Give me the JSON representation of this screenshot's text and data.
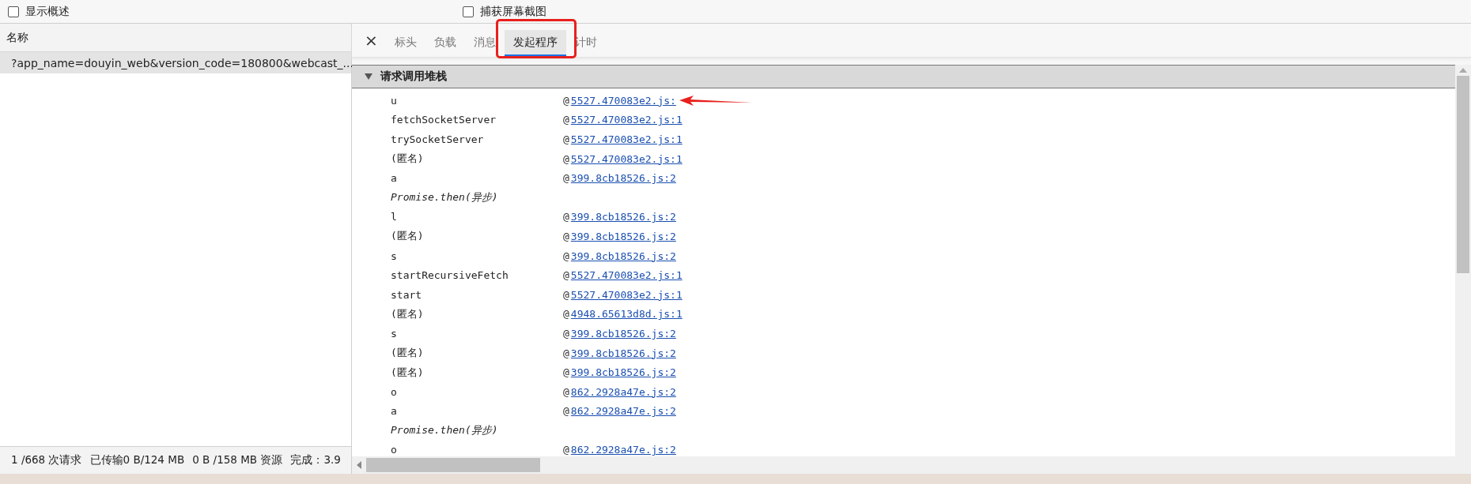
{
  "toolbar": {
    "options": [
      {
        "label": "显示概述",
        "checked": false
      },
      {
        "label": "捕获屏幕截图",
        "checked": false
      }
    ]
  },
  "requests": {
    "column": "名称",
    "rows": [
      {
        "name": "?app_name=douyin_web&version_code=180800&webcast_...",
        "selected": true
      }
    ]
  },
  "status_bar": [
    "1 /668 次请求",
    "已传输0 B/124 MB",
    "0 B /158 MB 资源",
    "完成：3.9"
  ],
  "detail": {
    "close": "×",
    "tabs": [
      {
        "label": "标头",
        "selected": false
      },
      {
        "label": "负载",
        "selected": false
      },
      {
        "label": "消息",
        "selected": false
      },
      {
        "label": "发起程序",
        "selected": true
      },
      {
        "label": "计时",
        "selected": false
      }
    ],
    "section": {
      "title": "请求调用堆栈",
      "expanded": true,
      "frames": [
        {
          "kind": "frame",
          "name": "u",
          "at": "@",
          "link": "5527.470083e2.js:"
        },
        {
          "kind": "frame",
          "name": "fetchSocketServer",
          "at": "@",
          "link": "5527.470083e2.js:1"
        },
        {
          "kind": "frame",
          "name": "trySocketServer",
          "at": "@",
          "link": "5527.470083e2.js:1"
        },
        {
          "kind": "frame",
          "name": "(匿名)",
          "at": "@",
          "link": "5527.470083e2.js:1"
        },
        {
          "kind": "frame",
          "name": "a",
          "at": "@",
          "link": "399.8cb18526.js:2"
        },
        {
          "kind": "async",
          "name": "Promise.then(异步)"
        },
        {
          "kind": "frame",
          "name": "l",
          "at": "@",
          "link": "399.8cb18526.js:2"
        },
        {
          "kind": "frame",
          "name": "(匿名)",
          "at": "@",
          "link": "399.8cb18526.js:2"
        },
        {
          "kind": "frame",
          "name": "s",
          "at": "@",
          "link": "399.8cb18526.js:2"
        },
        {
          "kind": "frame",
          "name": "startRecursiveFetch",
          "at": "@",
          "link": "5527.470083e2.js:1"
        },
        {
          "kind": "frame",
          "name": "start",
          "at": "@",
          "link": "5527.470083e2.js:1"
        },
        {
          "kind": "frame",
          "name": "(匿名)",
          "at": "@",
          "link": "4948.65613d8d.js:1"
        },
        {
          "kind": "frame",
          "name": "s",
          "at": "@",
          "link": "399.8cb18526.js:2"
        },
        {
          "kind": "frame",
          "name": "(匿名)",
          "at": "@",
          "link": "399.8cb18526.js:2"
        },
        {
          "kind": "frame",
          "name": "(匿名)",
          "at": "@",
          "link": "399.8cb18526.js:2"
        },
        {
          "kind": "frame",
          "name": "o",
          "at": "@",
          "link": "862.2928a47e.js:2"
        },
        {
          "kind": "frame",
          "name": "a",
          "at": "@",
          "link": "862.2928a47e.js:2"
        },
        {
          "kind": "async",
          "name": "Promise.then(异步)"
        },
        {
          "kind": "frame",
          "name": "o",
          "at": "@",
          "link": "862.2928a47e.js:2"
        }
      ]
    }
  }
}
